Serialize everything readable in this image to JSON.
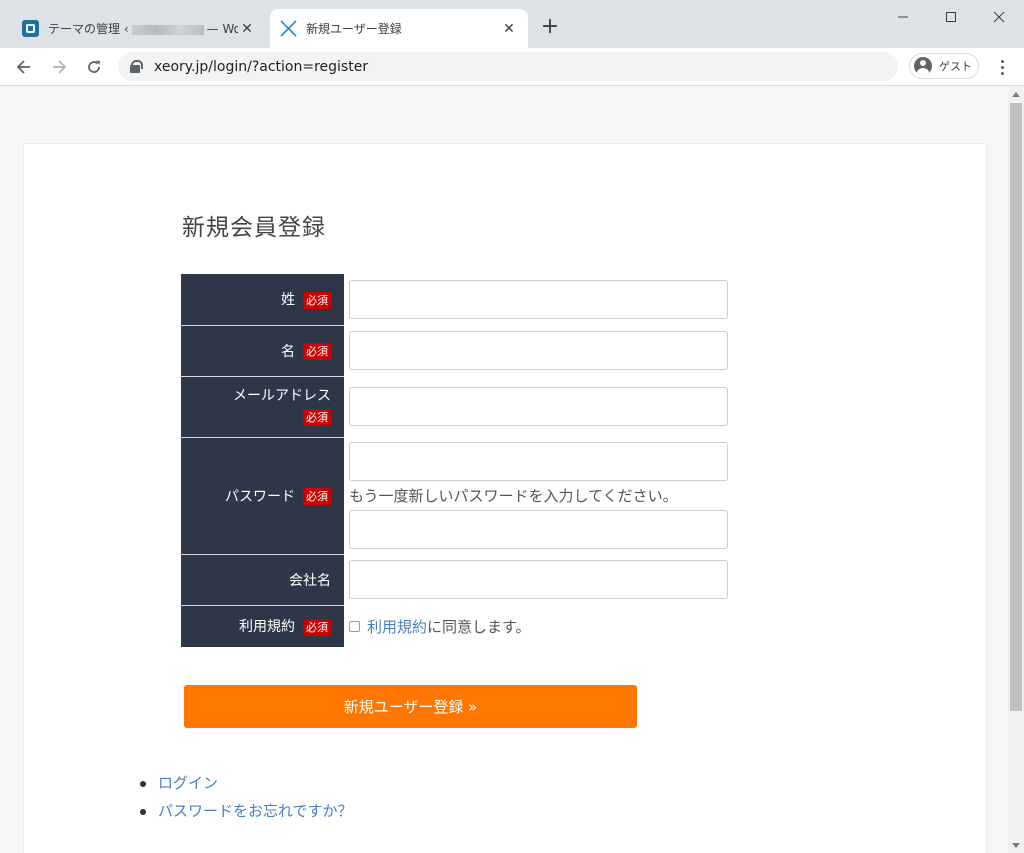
{
  "browser": {
    "tabs": [
      {
        "title_prefix": "テーマの管理 ‹",
        "title_suffix": "— Wor",
        "active": false
      },
      {
        "title": "新規ユーザー登録",
        "active": true
      }
    ],
    "url": "xeory.jp/login/?action=register",
    "profile_label": "ゲスト"
  },
  "page": {
    "title": "新規会員登録",
    "required_label": "必須",
    "fields": {
      "last_name": "姓",
      "first_name": "名",
      "email": "メールアドレス",
      "password": "パスワード",
      "password_confirm_hint": "もう一度新しいパスワードを入力してください。",
      "company": "会社名",
      "terms": "利用規約"
    },
    "terms_link": "利用規約",
    "terms_suffix": "に同意します。",
    "submit_label": "新規ユーザー登録 »",
    "links": [
      "ログイン",
      "パスワードをお忘れですか？"
    ]
  },
  "colors": {
    "header_bg": "#2d3748",
    "required_badge": "#cc0000",
    "submit_button": "#ff7700",
    "link": "#4a7fbf"
  }
}
